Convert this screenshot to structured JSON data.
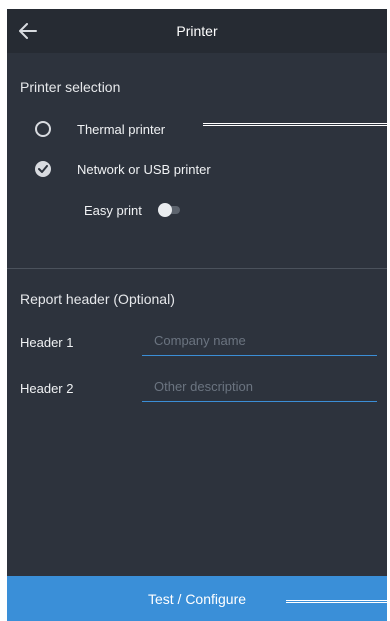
{
  "appbar": {
    "title": "Printer",
    "back_icon": "arrow-left-icon"
  },
  "printer_selection": {
    "title": "Printer selection",
    "options": [
      {
        "label": "Thermal printer",
        "selected": false
      },
      {
        "label": "Network or USB printer",
        "selected": true
      }
    ],
    "easy_print": {
      "label": "Easy print",
      "enabled": false
    }
  },
  "report_header": {
    "title": "Report header (Optional)",
    "fields": [
      {
        "label": "Header 1",
        "placeholder": "Company name",
        "value": ""
      },
      {
        "label": "Header 2",
        "placeholder": "Other description",
        "value": ""
      }
    ]
  },
  "footer": {
    "button_label": "Test / Configure"
  },
  "colors": {
    "background": "#2d333d",
    "appbar": "#262b33",
    "accent": "#3a8fd8",
    "underline": "#3b8ed6"
  }
}
